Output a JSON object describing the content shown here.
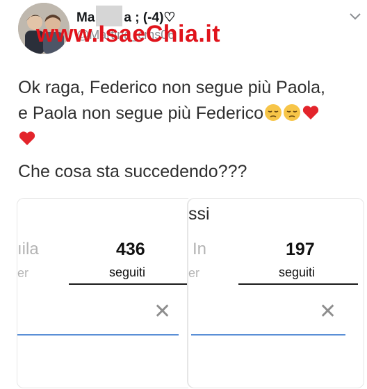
{
  "tweet": {
    "username_prefix": "Ma",
    "username_suffix": "a ; (-4)♡",
    "handle": "@Martina_cms06",
    "line1": "Ok raga, Federico non segue più Paola,",
    "line2": "e Paola non segue più Federico",
    "question": "Che cosa sta succedendo???"
  },
  "watermark": "www.IsaeChia.it",
  "left_panel": {
    "partial_count": "ıila",
    "partial_label": "er",
    "following_count": "436",
    "following_label": "seguiti"
  },
  "right_panel": {
    "partial_title": "ssi",
    "partial_count": "In",
    "partial_label": "er",
    "following_count": "197",
    "following_label": "seguiti"
  },
  "colors": {
    "watermark": "#e0141c",
    "search_underline": "#5a8fd6",
    "text": "#2f2f2f"
  },
  "icons": [
    "chevron-down-icon",
    "pensive-face-icon",
    "red-heart-icon",
    "close-icon"
  ]
}
